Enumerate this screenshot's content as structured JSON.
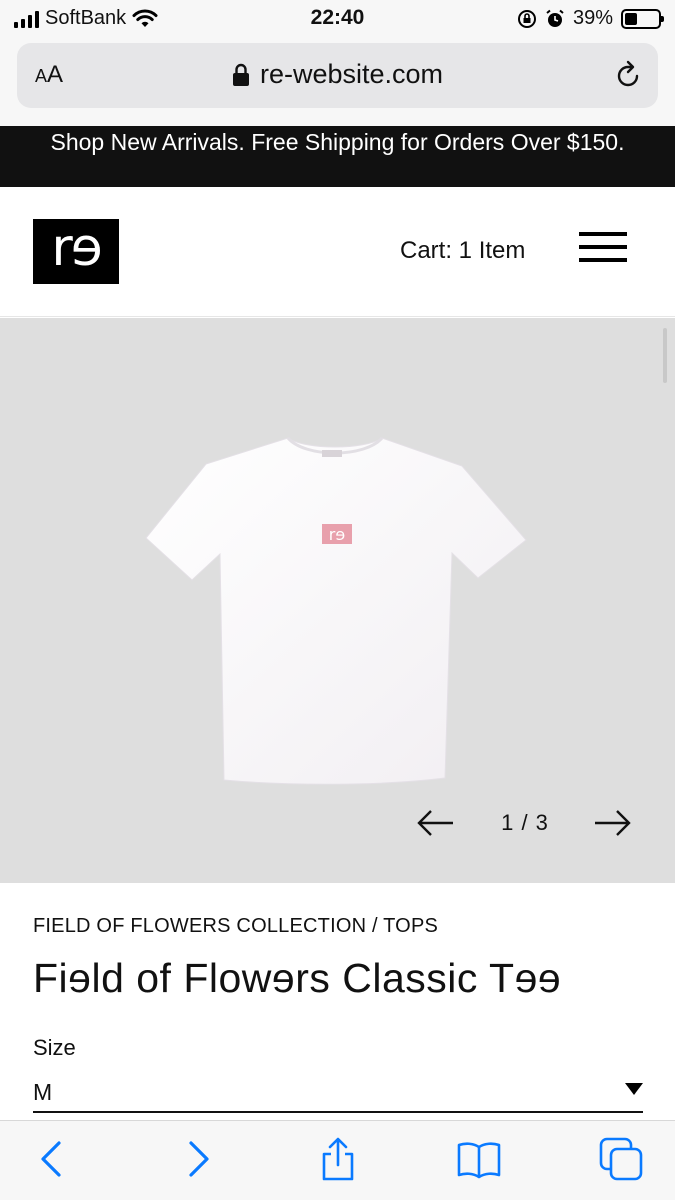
{
  "status_bar": {
    "carrier": "SoftBank",
    "time": "22:40",
    "battery_percent": "39%",
    "battery_level": 0.39,
    "icons": [
      "signal-icon",
      "wifi-icon",
      "orientation-lock-icon",
      "alarm-icon",
      "battery-icon"
    ]
  },
  "browser": {
    "text_size_label": "AA",
    "url": "re-website.com",
    "icons": [
      "lock-icon",
      "reload-icon"
    ]
  },
  "announcement": {
    "text": "Shop New Arrivals. Free Shipping for Orders Over $150."
  },
  "header": {
    "logo_text": "rɘ",
    "cart_label": "Cart: 1 Item",
    "icons": [
      "hamburger-menu-icon"
    ]
  },
  "gallery": {
    "counter": "1 / 3",
    "current": 1,
    "total": 3,
    "background": "#dedede",
    "icons": [
      "arrow-left-icon",
      "arrow-right-icon"
    ]
  },
  "product": {
    "breadcrumb": "FIELD OF FLOWERS COLLECTION / TOPS",
    "title": "Fiɘld of Flowɘrs Classic Tɘɘ",
    "size_label": "Size",
    "size_value": "M",
    "logo_color": "#e8a0ac"
  },
  "toolbar": {
    "icons": [
      "back-icon",
      "forward-icon",
      "share-icon",
      "bookmarks-icon",
      "tabs-icon"
    ],
    "accent": "#0a7aff"
  }
}
